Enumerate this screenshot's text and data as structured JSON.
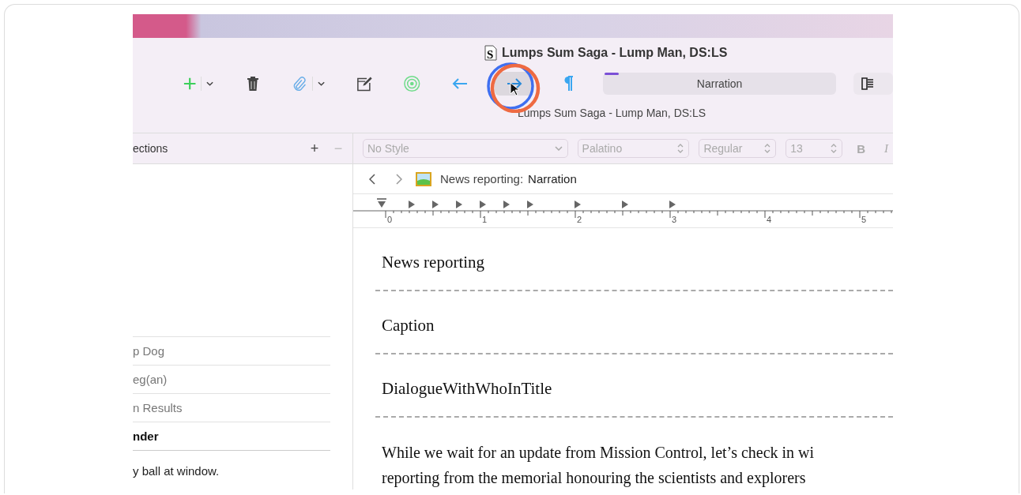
{
  "window": {
    "icon_letter": "S",
    "title": "Lumps Sum Saga - Lump Man, DS:LS",
    "subtitle": "Lumps Sum Saga - Lump Man, DS:LS"
  },
  "toolbar": {
    "buttons": [
      {
        "kind": "add",
        "menu": true,
        "hovered": false
      },
      {
        "kind": "trash",
        "menu": false,
        "hovered": false
      },
      {
        "kind": "attach",
        "menu": true,
        "hovered": false
      },
      {
        "kind": "compose",
        "menu": false,
        "hovered": false
      },
      {
        "kind": "target",
        "menu": false,
        "hovered": false
      },
      {
        "kind": "back",
        "menu": false,
        "hovered": false
      },
      {
        "kind": "forward",
        "menu": false,
        "hovered": true
      },
      {
        "kind": "pilcrow",
        "menu": false,
        "hovered": false
      }
    ],
    "section_type": "Narration"
  },
  "collections": {
    "header": "ections",
    "add": "+",
    "remove": "−",
    "rows": [
      {
        "label": "p Dog",
        "selected": false
      },
      {
        "label": "eg(an)",
        "selected": false
      },
      {
        "label": "n Results",
        "selected": false
      },
      {
        "label": "nder",
        "selected": true
      }
    ],
    "preview_text": "y ball at window."
  },
  "format_bar": {
    "style": "No Style",
    "font": "Palatino",
    "weight": "Regular",
    "size": "13",
    "bold": "B",
    "italic": "I"
  },
  "header_bar": {
    "label": "News reporting:",
    "section": "Narration"
  },
  "ruler": {
    "labels": [
      "0",
      "1",
      "2",
      "3",
      "4",
      "5"
    ]
  },
  "document": {
    "headings": [
      "News reporting",
      "Caption",
      "DialogueWithWhoInTitle"
    ],
    "paragraph_lines": [
      "While we wait for an update from Mission Control, let’s check in wi",
      "reporting from the memorial honouring the scientists and explorers"
    ]
  }
}
